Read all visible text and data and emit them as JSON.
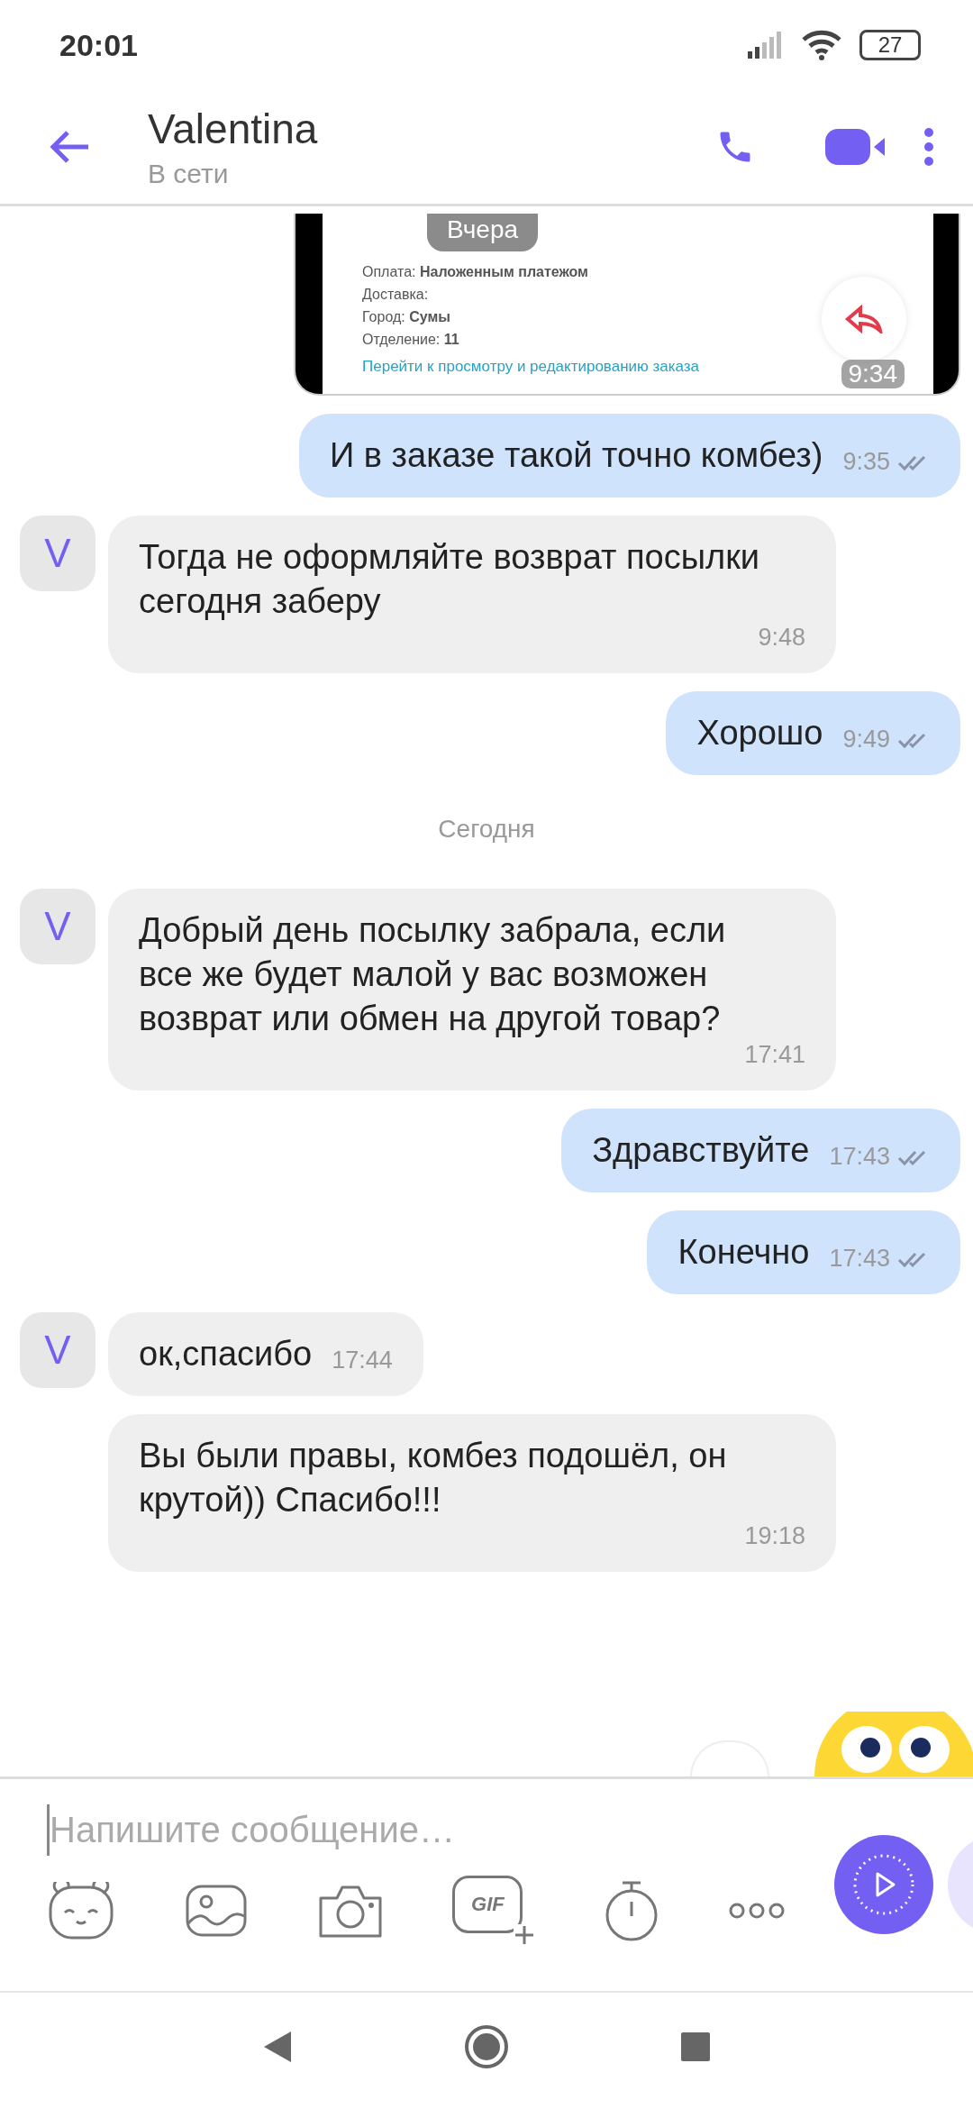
{
  "status_bar": {
    "time": "20:01",
    "battery": "27"
  },
  "header": {
    "title": "Valentina",
    "status": "В сети"
  },
  "forwarded_image": {
    "lines": [
      "Оплата: **Наложенным платежом**",
      "Доставка:",
      "Город: **Сумы**",
      "Отделение: **11**"
    ],
    "link": "Перейти к просмотру и редактированию заказа",
    "time": "9:34",
    "date_chip": "Вчера"
  },
  "messages": [
    {
      "kind": "outgoing",
      "text": "И в заказе такой точно комбез)",
      "time": "9:35",
      "read": true
    },
    {
      "kind": "incoming",
      "avatar": "V",
      "text": "Тогда не оформляйте возврат посылки сегодня заберу",
      "time": "9:48"
    },
    {
      "kind": "outgoing",
      "text": "Хорошо",
      "time": "9:49",
      "read": true
    },
    {
      "kind": "separator",
      "text": "Сегодня"
    },
    {
      "kind": "incoming",
      "avatar": "V",
      "text": "Добрый день посылку забрала, если все же будет малой у вас возможен возврат или обмен на другой товар?",
      "time": "17:41"
    },
    {
      "kind": "outgoing",
      "text": "Здравствуйте",
      "time": "17:43",
      "read": true
    },
    {
      "kind": "outgoing",
      "text": "Конечно",
      "time": "17:43",
      "read": true
    },
    {
      "kind": "incoming",
      "avatar": "V",
      "text": "ок,спасибо",
      "time": "17:44"
    },
    {
      "kind": "incoming",
      "text": "Вы были правы, комбез подошёл, он крутой)) Спасибо!!!",
      "time": "19:18"
    }
  ],
  "composer": {
    "placeholder": "Напишите сообщение…",
    "gif_label": "GIF"
  }
}
